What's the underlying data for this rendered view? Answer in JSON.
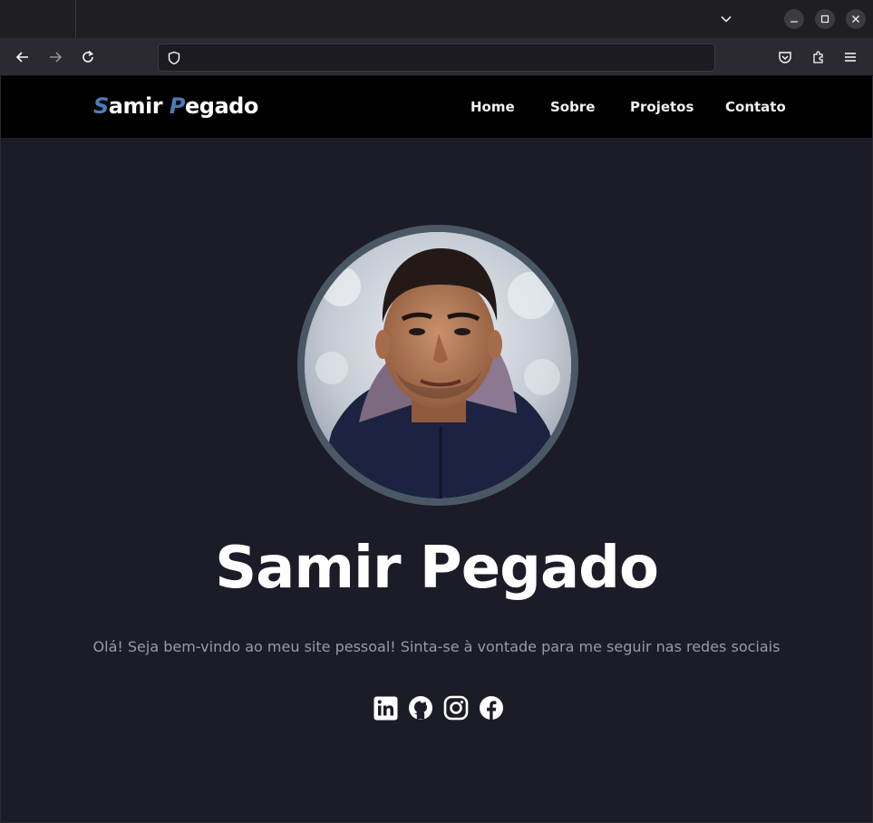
{
  "browser": {
    "url": "",
    "icons": {
      "back": "arrow-left-icon",
      "forward": "arrow-right-icon",
      "reload": "reload-icon",
      "shield": "shield-icon",
      "pocket": "pocket-icon",
      "extensions": "extensions-icon",
      "menu": "hamburger-menu-icon",
      "tab_list": "chevron-down-icon",
      "minimize": "minimize-icon",
      "maximize": "maximize-icon",
      "close": "close-icon"
    }
  },
  "site": {
    "brand": {
      "first_initial": "S",
      "first_rest": "amir ",
      "last_initial": "P",
      "last_rest": "egado"
    },
    "nav": [
      "Home",
      "Sobre",
      "Projetos",
      "Contato"
    ],
    "hero": {
      "name": "Samir Pegado",
      "intro": "Olá! Seja bem-vindo ao meu site pessoal! Sinta-se à vontade para me seguir nas redes sociais"
    },
    "socials": [
      "linkedin-icon",
      "github-icon",
      "instagram-icon",
      "facebook-icon"
    ],
    "colors": {
      "background": "#1b1c27",
      "nav_bg": "#000000",
      "accent": "#4b7bb5",
      "avatar_border": "#4a5866"
    }
  }
}
